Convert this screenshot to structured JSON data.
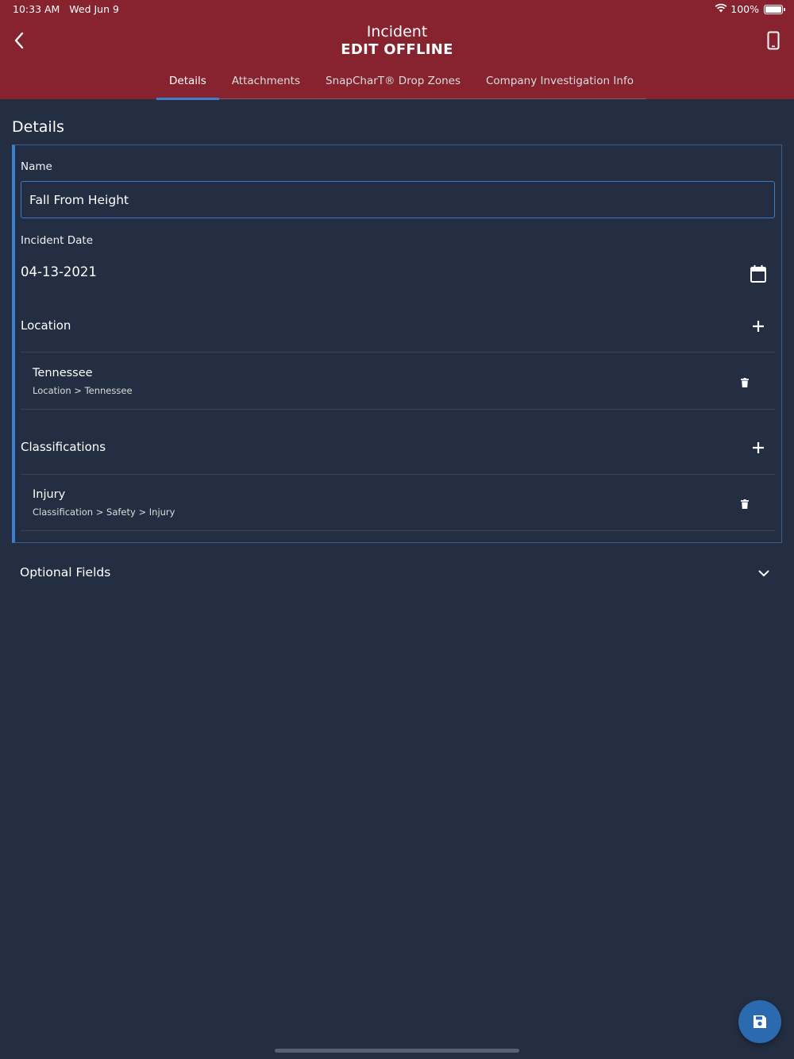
{
  "status_bar": {
    "time": "10:33 AM",
    "date": "Wed Jun 9",
    "battery": "100%"
  },
  "header": {
    "title": "Incident",
    "subtitle": "EDIT OFFLINE",
    "tabs": [
      {
        "label": "Details",
        "active": true
      },
      {
        "label": "Attachments",
        "active": false
      },
      {
        "label": "SnapCharT® Drop Zones",
        "active": false
      },
      {
        "label": "Company Investigation Info",
        "active": false
      }
    ]
  },
  "main": {
    "section_title": "Details",
    "name_label": "Name",
    "name_value": "Fall From Height",
    "incident_date_label": "Incident Date",
    "incident_date_value": "04-13-2021",
    "location": {
      "title": "Location",
      "items": [
        {
          "name": "Tennessee",
          "path": "Location > Tennessee"
        }
      ]
    },
    "classifications": {
      "title": "Classifications",
      "items": [
        {
          "name": "Injury",
          "path": "Classification > Safety > Injury"
        }
      ]
    },
    "optional_fields_label": "Optional Fields"
  },
  "colors": {
    "header_bg": "#86232f",
    "page_bg": "#232e42",
    "accent": "#3a7fd0",
    "fab_bg": "#2c6ab0"
  },
  "icons": [
    "chevron-left-icon",
    "phone-device-icon",
    "wifi-icon",
    "battery-icon",
    "calendar-icon",
    "plus-icon",
    "trash-icon",
    "chevron-down-icon",
    "save-icon"
  ]
}
